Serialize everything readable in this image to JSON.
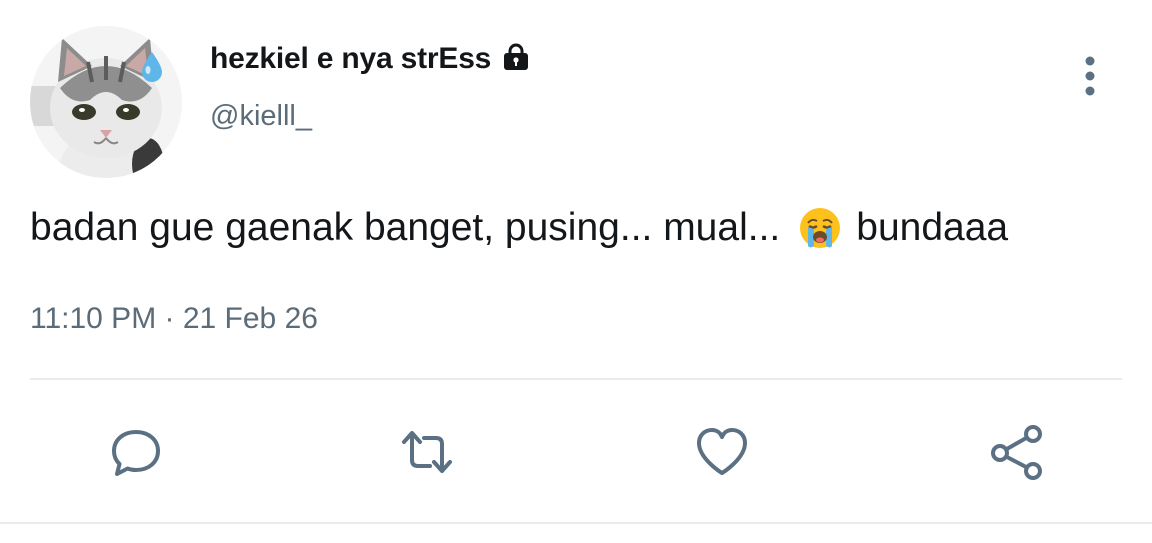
{
  "tweet": {
    "display_name": "hezkiel e nya strEss",
    "handle": "@kielll_",
    "text_before_emoji": "badan gue gaenak banget, pusing... mual...",
    "emoji": "loudly-crying-face",
    "text_after_emoji": "bundaaa",
    "timestamp": "11:10 PM · 21 Feb 26",
    "protected_account": true
  },
  "avatar": {
    "subject": "cat-with-sweat-drop"
  },
  "actions": [
    {
      "name": "reply",
      "icon": "reply-icon"
    },
    {
      "name": "retweet",
      "icon": "retweet-icon"
    },
    {
      "name": "like",
      "icon": "heart-icon"
    },
    {
      "name": "share",
      "icon": "share-icon"
    }
  ],
  "colors": {
    "text_primary": "#14171a",
    "text_secondary": "#5b6b78",
    "icon_gray": "#5b7083",
    "divider": "#e6ecf0"
  }
}
